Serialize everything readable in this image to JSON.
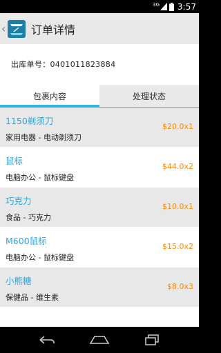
{
  "status_bar": {
    "network": "3G",
    "time": "3:57"
  },
  "action_bar": {
    "title": "订单详情",
    "back_icon": "chevron-left-icon",
    "logo_icon": "app-logo-icon"
  },
  "order": {
    "label": "出库单号：0401011823884"
  },
  "tabs": [
    {
      "label": "包裹内容",
      "active": true
    },
    {
      "label": "处理状态",
      "active": false
    }
  ],
  "items": [
    {
      "name": "1150剃须刀",
      "category": "家用电器 - 电动剃须刀",
      "price": "$20.0x1"
    },
    {
      "name": "鼠标",
      "category": "电脑办公 - 鼠标键盘",
      "price": "$44.0x2"
    },
    {
      "name": "巧克力",
      "category": "食品 - 巧克力",
      "price": "$10.0x1"
    },
    {
      "name": "M600鼠标",
      "category": "电脑办公 - 鼠标键盘",
      "price": "$15.0x2"
    },
    {
      "name": "小熊糖",
      "category": "保健品 - 维生素",
      "price": "$8.0x3"
    }
  ],
  "colors": {
    "accent": "#33b5e5",
    "price": "#ff8a00",
    "item_name": "#33a3dc",
    "row_gray": "#e8e8e8"
  }
}
